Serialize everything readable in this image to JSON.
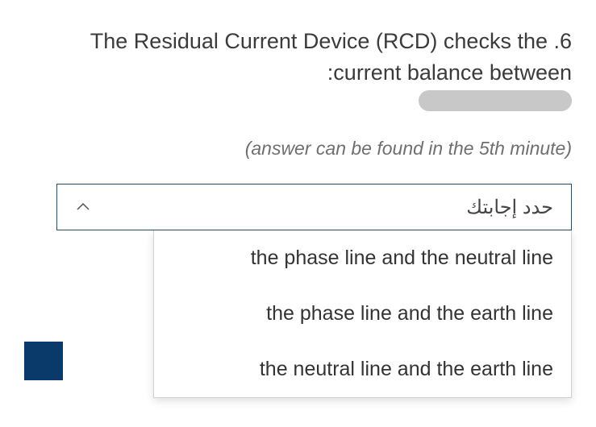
{
  "question": {
    "line1": "The Residual Current Device (RCD) checks the .6",
    "line2": ":current balance between"
  },
  "hint": "(answer can be found in the 5th minute)",
  "dropdown": {
    "placeholder": "حدد إجابتك",
    "options": [
      "the phase line and the neutral line",
      "the phase line and the earth line",
      "the neutral line and the earth line"
    ]
  }
}
